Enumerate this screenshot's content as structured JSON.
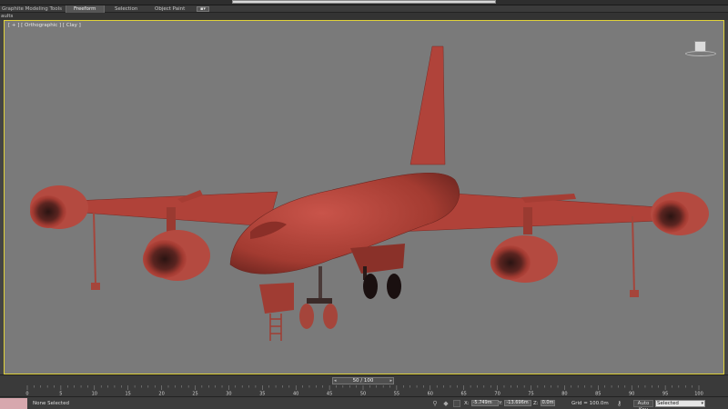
{
  "ribbon": {
    "title": "Graphite Modeling Tools",
    "tabs": [
      "Freeform",
      "Selection",
      "Object Paint"
    ],
    "active_tab": "Freeform",
    "dropdown_icon": "▪▾"
  },
  "subbar": {
    "label": "aults"
  },
  "viewport": {
    "label": "[ + ] [ Orthographic ] [ Clay ]",
    "cube_label": "view-cube-icon"
  },
  "timeline": {
    "slider_text": "50 / 100",
    "ruler_ticks": [
      "0",
      "5",
      "10",
      "15",
      "20",
      "25",
      "30",
      "35",
      "40",
      "45",
      "50",
      "55",
      "60",
      "65",
      "70",
      "75",
      "80",
      "85",
      "90",
      "95",
      "100"
    ]
  },
  "status": {
    "selection_text": "None Selected",
    "x_label": "X:",
    "x_value": "-5.749m",
    "y_label": "Y:",
    "y_value": "-13.696m",
    "z_label": "Z:",
    "z_value": "0.0m",
    "grid_text": "Grid = 100.0m",
    "autokey_label": "Auto Key",
    "selected_dropdown": "Selected"
  },
  "colors": {
    "viewport_bg": "#7a7a7a",
    "model": "#b8453a",
    "viewport_border": "#e1d23a",
    "status_pink": "#d7a8ae"
  }
}
